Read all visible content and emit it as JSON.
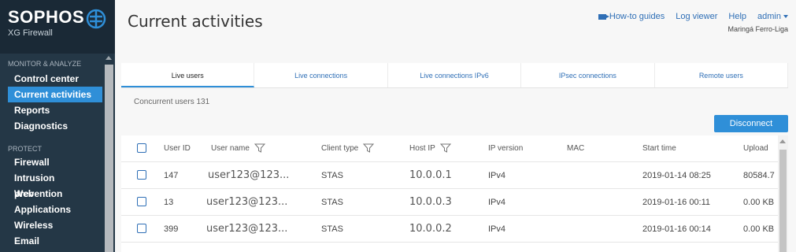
{
  "brand": {
    "name": "SOPHOS",
    "product": "XG Firewall"
  },
  "page_title": "Current activities",
  "top_links": {
    "howto": "How-to guides",
    "log_viewer": "Log viewer",
    "help": "Help",
    "user": "admin",
    "company": "Maringá Ferro-Liga"
  },
  "sidebar": {
    "section1": "MONITOR & ANALYZE",
    "items1": [
      "Control center",
      "Current activities",
      "Reports",
      "Diagnostics"
    ],
    "section2": "PROTECT",
    "items2": [
      "Firewall",
      "Intrusion prevention",
      "Web",
      "Applications",
      "Wireless",
      "Email"
    ]
  },
  "tabs": [
    "Live users",
    "Live connections",
    "Live connections IPv6",
    "IPsec connections",
    "Remote users"
  ],
  "concurrent": "Concurrent users 131",
  "disconnect_label": "Disconnect",
  "table": {
    "headers": [
      "User ID",
      "User name",
      "Client type",
      "Host IP",
      "IP version",
      "MAC",
      "Start time",
      "Upload"
    ],
    "rows": [
      {
        "id": "147",
        "name": "user123@123...",
        "client": "STAS",
        "ip": "10.0.0.1",
        "ipver": "IPv4",
        "mac": "",
        "start": "2019-01-14 08:25",
        "upload": "80584.7"
      },
      {
        "id": "13",
        "name": "user123@123...",
        "client": "STAS",
        "ip": "10.0.0.3",
        "ipver": "IPv4",
        "mac": "",
        "start": "2019-01-16 00:11",
        "upload": "0.00 KB"
      },
      {
        "id": "399",
        "name": "user123@123...",
        "client": "STAS",
        "ip": "10.0.0.2",
        "ipver": "IPv4",
        "mac": "",
        "start": "2019-01-16 00:14",
        "upload": "0.00 KB"
      }
    ]
  },
  "colors": {
    "sidebar_bg": "#1a2936",
    "accent": "#2f8fd8",
    "link": "#2f6fb6"
  }
}
